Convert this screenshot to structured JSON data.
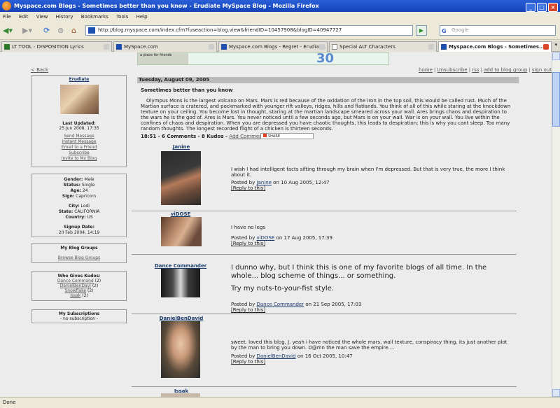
{
  "window": {
    "title": "Myspace.com Blogs - Sometimes better than you know - Erudiate MySpace Blog - Mozilla Firefox"
  },
  "menu": [
    "File",
    "Edit",
    "View",
    "History",
    "Bookmarks",
    "Tools",
    "Help"
  ],
  "nav": {
    "url": "http://blog.myspace.com/index.cfm?fuseaction=blog.view&friendID=10457908&blogID=40947727",
    "search_placeholder": "Google"
  },
  "tabs": [
    {
      "label": "LT TOOL - DISPOSITION Lyrics",
      "active": false
    },
    {
      "label": "MySpace.com",
      "active": false
    },
    {
      "label": "Myspace.com Blogs - Regret - Erudiat...",
      "active": false
    },
    {
      "label": "Special ALT Characters",
      "active": false
    },
    {
      "label": "Myspace.com Blogs - Sometimes...",
      "active": true
    }
  ],
  "banner": {
    "text": "a place for friends",
    "number": "30"
  },
  "back_link": "< Back",
  "profile": {
    "name": "Erudiate",
    "last_updated_label": "Last Updated:",
    "last_updated": "25 Jun 2008, 17:35",
    "links": [
      "Send Message",
      "Instant Message",
      "Email to a Friend",
      "Subscribe",
      "Invite to My Blog"
    ]
  },
  "info": {
    "rows": [
      [
        "Gender:",
        "Male"
      ],
      [
        "Status:",
        "Single"
      ],
      [
        "Age:",
        "24"
      ],
      [
        "Sign:",
        "Capricorn"
      ]
    ],
    "rows2": [
      [
        "City:",
        "Lodi"
      ],
      [
        "State:",
        "CALIFORNIA"
      ],
      [
        "Country:",
        "US"
      ]
    ],
    "signup_label": "Signup Date:",
    "signup": "20 Feb 2004, 14:19"
  },
  "groups": {
    "title": "My Blog Groups",
    "link": "Browse Blog Groups"
  },
  "kudos": {
    "title": "Who Gives Kudos:",
    "items": [
      [
        "Dance Command",
        "(2)"
      ],
      [
        "DanielBenDavi",
        "(2)"
      ],
      [
        "Snowflake",
        "(2)"
      ],
      [
        "Issak",
        "(2)"
      ]
    ]
  },
  "subs": {
    "title": "My Subscriptions",
    "text": "- no subscription -"
  },
  "topnav": [
    "home",
    "Unsubscribe",
    "rss",
    "add to blog group",
    "sign out"
  ],
  "post": {
    "date": "Tuesday, August 09, 2005",
    "title": "Sometimes better than you know",
    "body": "Olympus Mons is the largest volcano on Mars. Mars is red because of the oxidation of the iron in the top soil, this would be called rust. Much of the Martian surface is cratered, and pockmarked with younger rift valleys, ridges, hills and flatlands. You think of all of this while staring at the knockdown texture on your ceiling. You become lost in thought, staring at the martian landscape smeared across your wall. Ares brings chaos and despiration to the wars he is the god of. Ares is Mars. You never noticed until a few seconds ago, but Mars is on your wall. War is on your wall. You live within the confines of chaos and despiration. When you are depressed you have chaotic thoughts, this leads to despiration; this is why you cant sleep. Too many random thoughts. The longest recorded flight of a chicken is thirteen seconds.",
    "meta": "18:51 - 6 Comments - 8 Kudos -",
    "add_comment": "Add Comment",
    "share": "SHARE"
  },
  "comments": [
    {
      "name": "Janine",
      "text": "I wish I had intelligent facts sifting through my brain when I'm depressed. But that is very true, the more I think about it.",
      "posted": "Posted by",
      "on": "on 10 Aug 2005, 12:47",
      "reply": "[Reply to this]"
    },
    {
      "name": "viDOSE",
      "text": "I have no legs",
      "posted": "Posted by",
      "on": "on 17 Aug 2005, 17:39",
      "reply": "[Reply to this]"
    },
    {
      "name": "Dance Commander",
      "text": "I dunno why, but I think this is one of my favorite blogs of all time. In the whole... blog scheme of things... or something.",
      "text2": "Try my nuts-to-your-fist style.",
      "posted": "Posted by",
      "on": "on 21 Sep 2005, 17:03",
      "reply": "[Reply to this]"
    },
    {
      "name": "DanielBenDavid",
      "text": "sweet. loved this blog, J. yeah i have noticed the whole mars, wall texture, conspiracy thing. its just another plot by the man to bring you down. D@mn the man save the empire....",
      "posted": "Posted by",
      "on": "on 16 Oct 2005, 10:47",
      "reply": "[Reply to this]"
    },
    {
      "name": "Issak"
    }
  ],
  "status": "Done"
}
